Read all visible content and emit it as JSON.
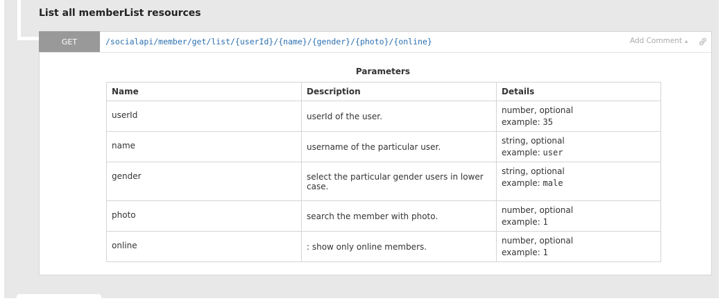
{
  "resource": {
    "title": "List all memberList resources"
  },
  "request": {
    "method": "GET",
    "uri": "/socialapi/member/get/list/{userId}/{name}/{gender}/{photo}/{online}",
    "add_comment_label": "Add Comment"
  },
  "parameters": {
    "caption": "Parameters",
    "headers": {
      "name": "Name",
      "description": "Description",
      "details": "Details"
    },
    "rows": [
      {
        "name": "userId",
        "description": "userId of the user.",
        "details_type": "number, optional",
        "example_label": "example:",
        "example_value": "35",
        "row_height": 44
      },
      {
        "name": "name",
        "description": "username of the particular user.",
        "details_type": "string, optional",
        "example_label": "example:",
        "example_value": "user",
        "row_height": 44
      },
      {
        "name": "gender",
        "description": "select the particular gender users in lower case.",
        "details_type": "string, optional",
        "example_label": "example:",
        "example_value": "male",
        "row_height": 56
      },
      {
        "name": "photo",
        "description": "search the member with photo.",
        "details_type": "number, optional",
        "example_label": "example:",
        "example_value": "1",
        "row_height": 44
      },
      {
        "name": "online",
        "description": ": show only online members.",
        "details_type": "number, optional",
        "example_label": "example:",
        "example_value": "1",
        "row_height": 44
      }
    ]
  }
}
